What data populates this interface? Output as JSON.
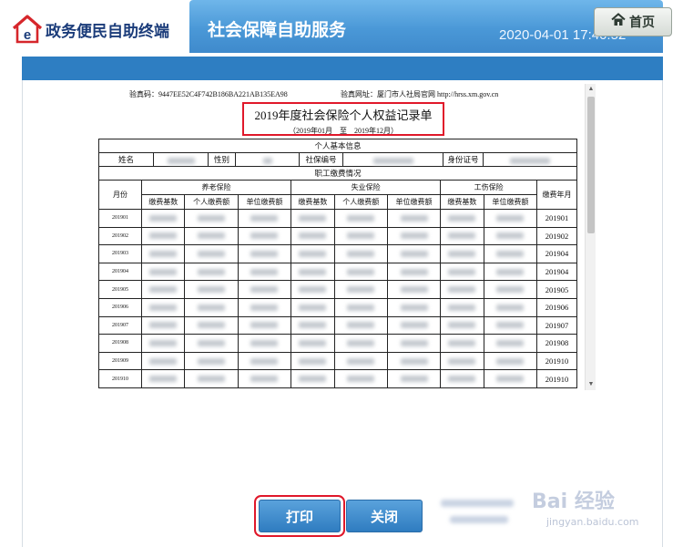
{
  "header": {
    "logo_text": "政务便民自助终端",
    "title": "社会保障自助服务",
    "clock": "2020-04-01 17:40:52",
    "home_label": "首页",
    "colors": {
      "title_bar": "#4a98d7",
      "content_strip": "#2e7ec2",
      "logo": "#1b3c7a",
      "logo_accent": "#d6262b"
    }
  },
  "document": {
    "verification_code_label": "验真码：",
    "verification_code": "9447EE52C4F742B186BA221AB135EA98",
    "verification_site_label": "验真网址：",
    "verification_site": "厦门市人社局官网 http://hrss.xm.gov.cn",
    "title": "2019年度社会保险个人权益记录单",
    "period": "（2019年01月　至　2019年12月）",
    "basic_info": {
      "section_title": "个人基本信息",
      "name_label": "姓名",
      "gender_label": "性别",
      "ssn_label": "社保编号",
      "id_label": "身份证号"
    },
    "payment": {
      "section_title": "职工缴费情况",
      "month_label": "月份",
      "groups": [
        "养老保险",
        "失业保险",
        "工伤保险"
      ],
      "subheaders": [
        "缴费基数",
        "个人缴费额",
        "单位缴费额",
        "缴费基数",
        "个人缴费额",
        "单位缴费额",
        "缴费基数",
        "单位缴费额"
      ],
      "pay_month_label": "缴费年月",
      "rows": [
        {
          "month": "201901",
          "pay_month": "201901"
        },
        {
          "month": "201902",
          "pay_month": "201902"
        },
        {
          "month": "201903",
          "pay_month": "201904"
        },
        {
          "month": "201904",
          "pay_month": "201904"
        },
        {
          "month": "201905",
          "pay_month": "201905"
        },
        {
          "month": "201906",
          "pay_month": "201906"
        },
        {
          "month": "201907",
          "pay_month": "201907"
        },
        {
          "month": "201908",
          "pay_month": "201908"
        },
        {
          "month": "201909",
          "pay_month": "201910"
        },
        {
          "month": "201910",
          "pay_month": "201910"
        }
      ]
    }
  },
  "buttons": {
    "print": "打印",
    "close": "关闭"
  },
  "watermark": {
    "name": "Bai 经验",
    "url": "jingyan.baidu.com"
  }
}
